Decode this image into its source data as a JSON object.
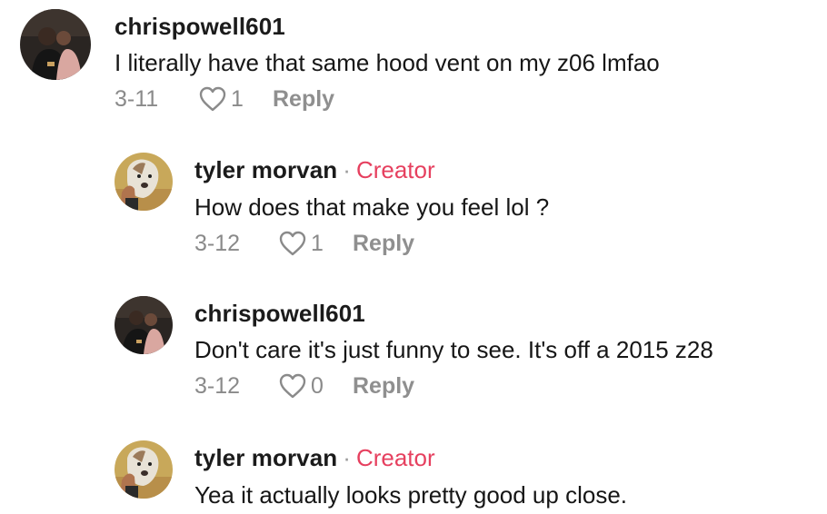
{
  "comments": [
    {
      "username": "chrispowell601",
      "is_creator": false,
      "text": "I literally have that same hood vent on my z06 lmfao",
      "date": "3-11",
      "likes": "1",
      "reply_label": "Reply",
      "avatar": "chrispowell-avatar"
    },
    {
      "username": "tyler morvan",
      "is_creator": true,
      "creator_sep": "·",
      "creator_label": "Creator",
      "text": "How does that make you feel lol ?",
      "date": "3-12",
      "likes": "1",
      "reply_label": "Reply",
      "avatar": "tyler-avatar"
    },
    {
      "username": "chrispowell601",
      "is_creator": false,
      "text": "Don't care it's just funny to see. It's off a 2015 z28",
      "date": "3-12",
      "likes": "0",
      "reply_label": "Reply",
      "avatar": "chrispowell-avatar"
    },
    {
      "username": "tyler morvan",
      "is_creator": true,
      "creator_sep": "·",
      "creator_label": "Creator",
      "text": "Yea it actually looks pretty good up close.",
      "avatar": "tyler-avatar"
    }
  ],
  "colors": {
    "creator": "#e6405f",
    "meta": "#8a8a8a",
    "text": "#161616"
  },
  "icons": {
    "like": "heart-outline-icon"
  }
}
